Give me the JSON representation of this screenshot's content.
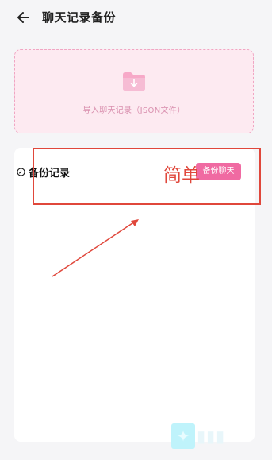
{
  "header": {
    "back_icon": "arrow-left-icon",
    "title": "聊天记录备份"
  },
  "import": {
    "icon": "folder-download-icon",
    "label": "导入聊天记录（JSON文件）"
  },
  "records": {
    "icon": "clock-icon",
    "title": "备份记录",
    "backup_button": "备份聊天"
  },
  "annotation": {
    "text": "简单",
    "color": "#e0473b"
  },
  "colors": {
    "accent": "#f06aa2",
    "import_bg": "#fdeaf1"
  }
}
